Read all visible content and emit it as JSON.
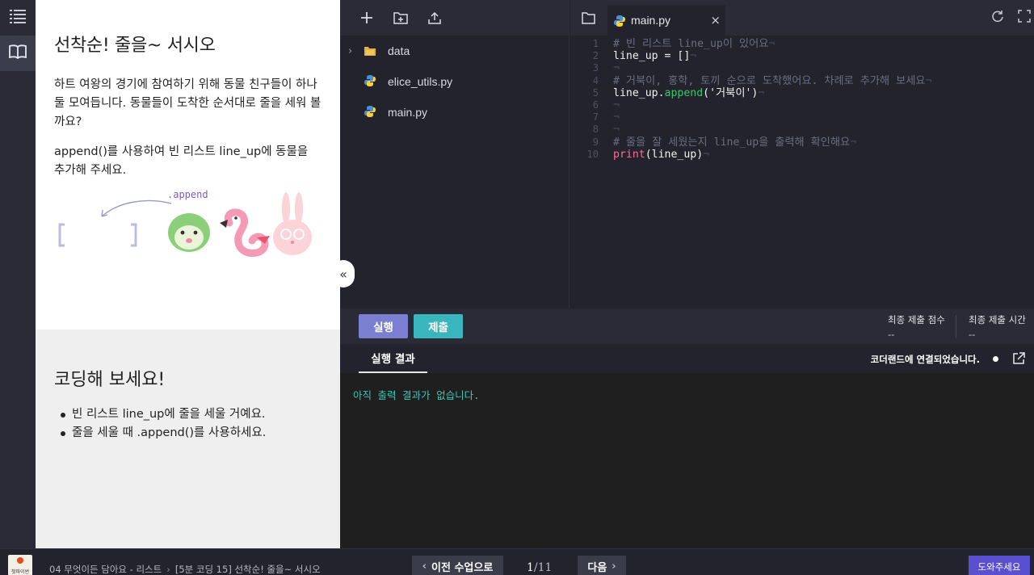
{
  "lesson": {
    "title": "선착순! 줄을~ 서시오",
    "paragraph1": "하트 여왕의 경기에 참여하기 위해 동물 친구들이 하나둘 모여듭니다. 동물들이 도착한 순서대로 줄을 세워 볼까요?",
    "paragraph2": "append()를 사용하여 빈 리스트 line_up에 동물을 추가해 주세요.",
    "illustration_label": ".append",
    "practice_title": "코딩해 보세요!",
    "bullets": [
      "빈 리스트 line_up에 줄을 세울 거예요.",
      "줄을 세울 때 .append()를 사용하세요."
    ]
  },
  "collapse_label": "«",
  "explorer": {
    "files": [
      {
        "name": "data",
        "icon": "folder-icon",
        "expandable": true
      },
      {
        "name": "elice_utils.py",
        "icon": "python-icon",
        "expandable": false
      },
      {
        "name": "main.py",
        "icon": "python-icon",
        "expandable": false
      }
    ]
  },
  "editor": {
    "tab_name": "main.py",
    "close_label": "×",
    "line_numbers": [
      "1",
      "2",
      "3",
      "4",
      "5",
      "6",
      "7",
      "8",
      "9",
      "10"
    ],
    "code": {
      "l1": "# 빈 리스트 line_up이 있어요",
      "l2": "line_up = []",
      "l4": "# 거북이, 홍학, 토끼 순으로 도착했어요. 차례로 추가해 보세요",
      "l5_pre": "line_up.",
      "l5_fn": "append",
      "l5_post": "('거북이')",
      "l9": "# 줄을 잘 세웠는지 line_up을 출력해 확인해요",
      "l10_kw": "print",
      "l10_post": "(line_up)"
    },
    "eol_marker": "¬"
  },
  "actions": {
    "run": "실행",
    "submit": "제출",
    "last_score_label": "최종 제출 점수",
    "last_score_value": "--",
    "last_time_label": "최종 제출 시간",
    "last_time_value": "--"
  },
  "output": {
    "tab": "실행 결과",
    "connection": "코더랜드에 연결되었습니다.",
    "text": "아직 출력 결과가 없습니다."
  },
  "footer": {
    "logo_text": "첫파이썬",
    "crumb_course": "04 무엇이든 담아요 - 리스트",
    "crumb_lesson": "[5분 코딩 15] 선착순! 줄을~ 서시오",
    "prev": "이전 수업으로",
    "page_current": "1",
    "page_total": "/11",
    "next": "다음",
    "help": "도와주세요"
  },
  "colors": {
    "run": "#7b7fd1",
    "submit": "#39b6bd",
    "help": "#5a4fcf",
    "output_text": "#3cc7b3"
  }
}
